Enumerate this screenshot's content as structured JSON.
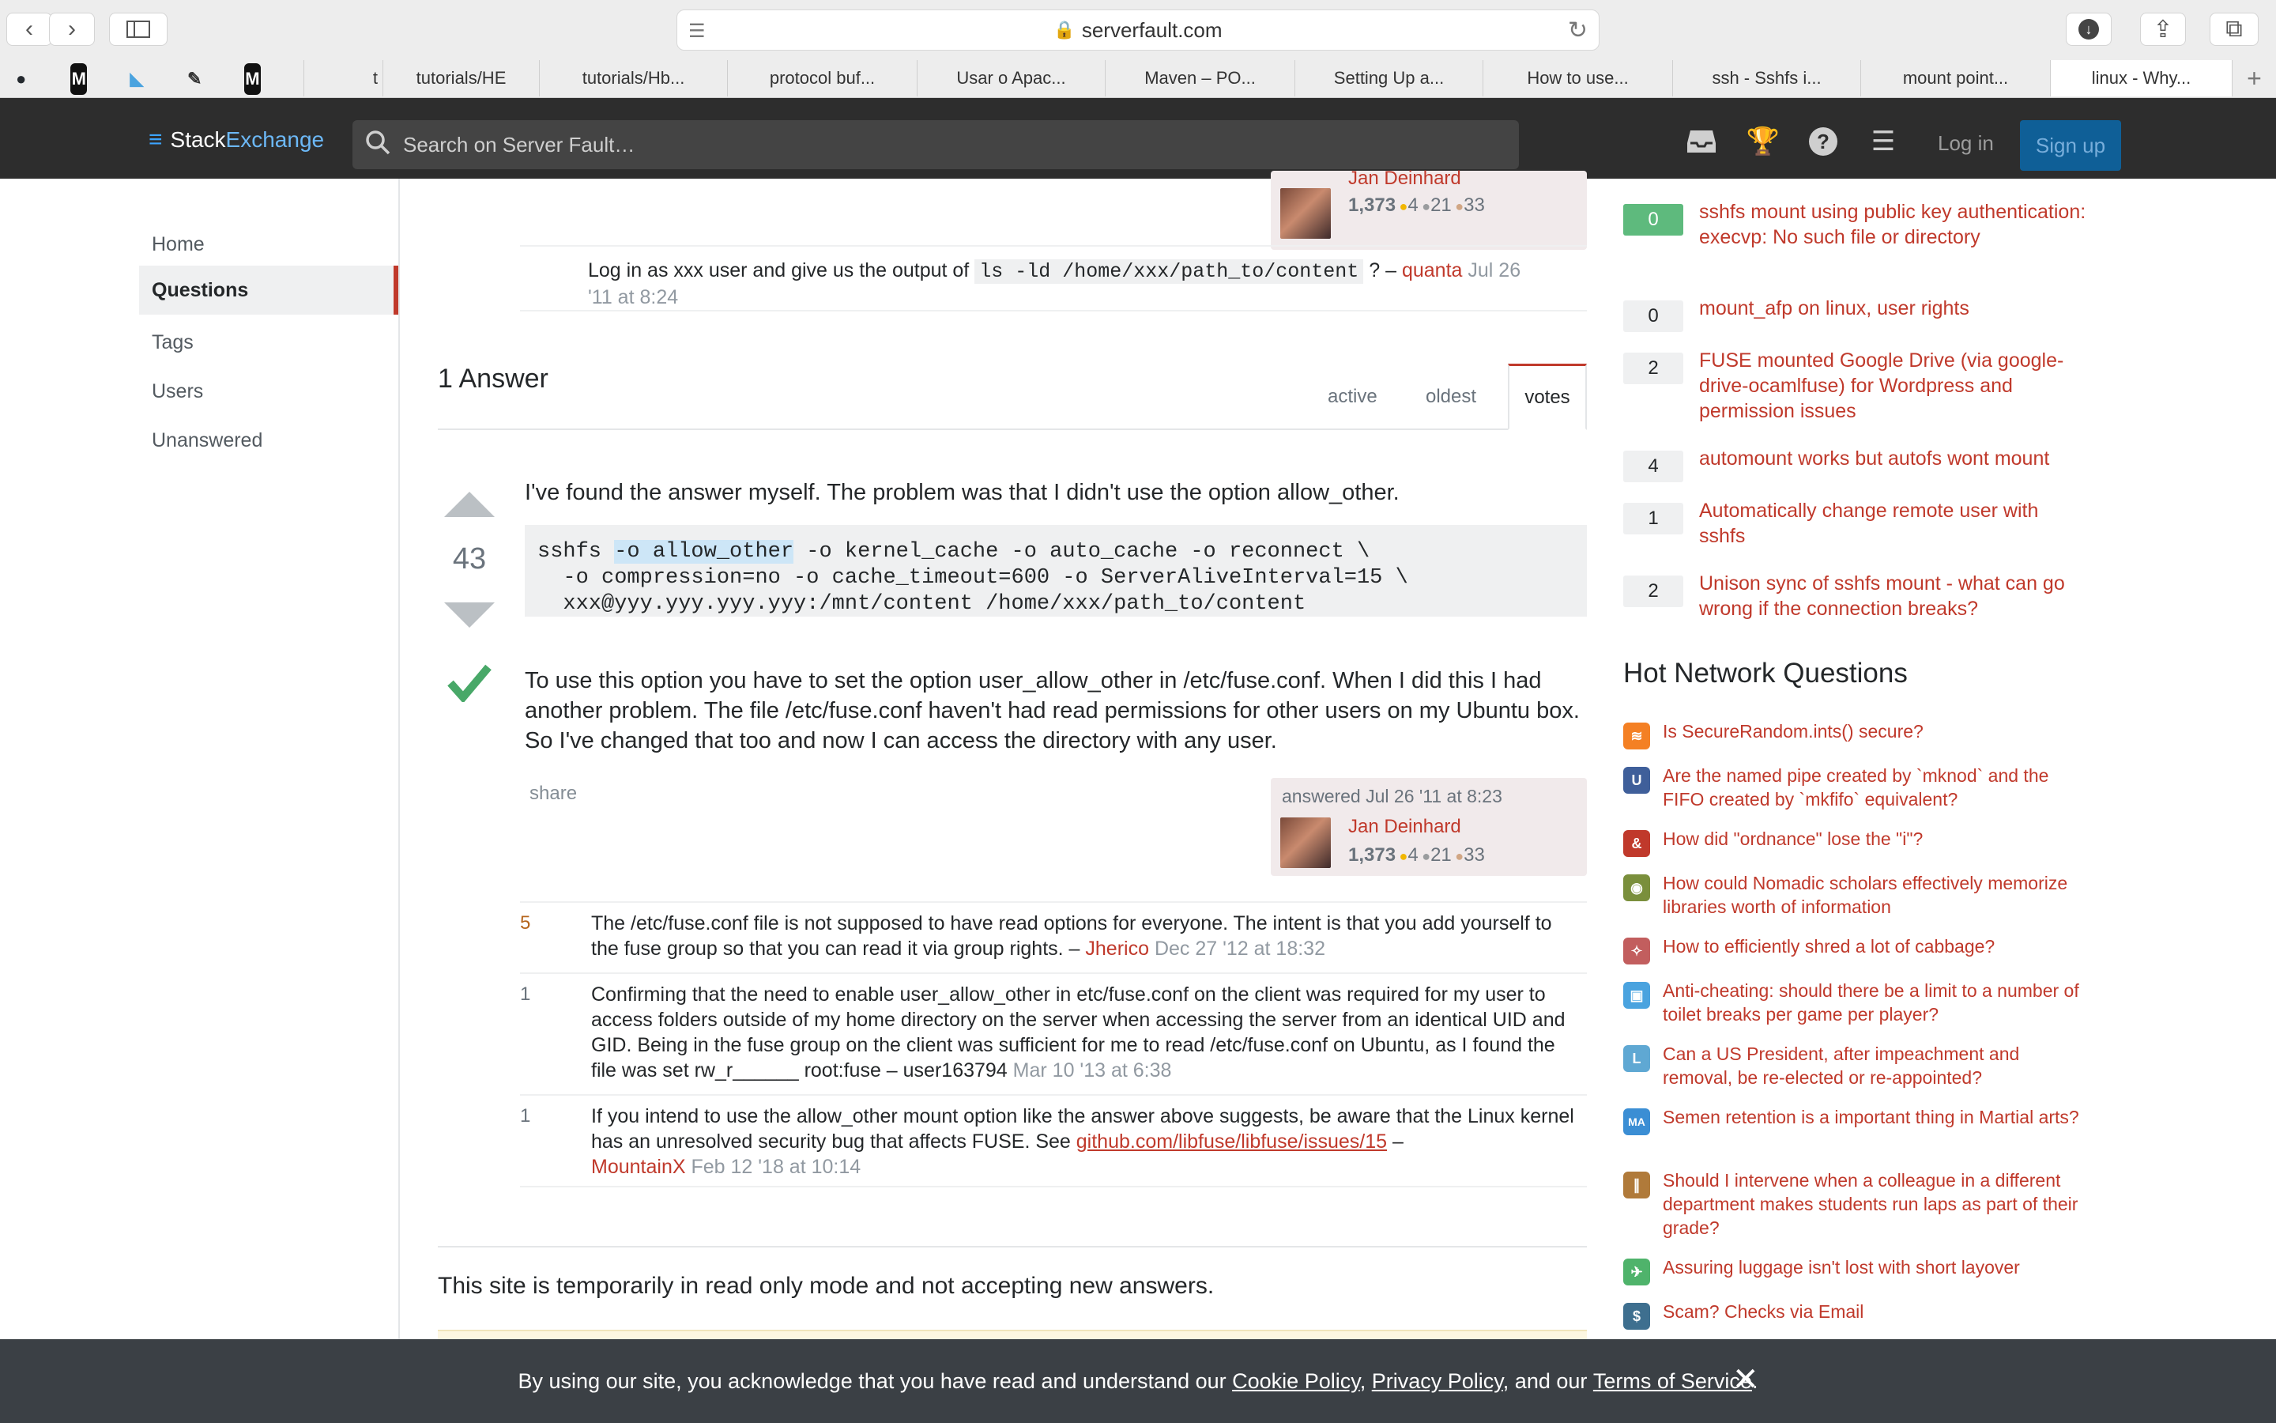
{
  "browser": {
    "url": "serverfault.com",
    "tabs": [
      "t",
      "tutorials/HE",
      "tutorials/Hb...",
      "protocol buf...",
      "Usar o Apac...",
      "Maven – PO...",
      "Setting Up a...",
      "How to use...",
      "ssh - Sshfs i...",
      "mount point...",
      "linux - Why..."
    ],
    "favicons": [
      "github-icon",
      "medium-icon",
      "bookmark-icon",
      "pin-icon",
      "medium-icon"
    ]
  },
  "header": {
    "brand_a": "Stack",
    "brand_b": "Exchange",
    "search_placeholder": "Search on Server Fault…",
    "login": "Log in",
    "signup": "Sign up"
  },
  "leftnav": {
    "items": [
      "Home",
      "Questions",
      "Tags",
      "Users",
      "Unanswered"
    ],
    "active": "Questions"
  },
  "question_signature": {
    "name": "Jan Deinhard",
    "rep": "1,373",
    "gold": "4",
    "silver": "21",
    "bronze": "33"
  },
  "question_comment": {
    "text_before": "Log in as xxx user and give us the output of",
    "code": "ls -ld /home/xxx/path_to/content",
    "text_after": "? –",
    "user": "quanta",
    "date_line1": "Jul 26",
    "date_line2": "'11 at 8:24"
  },
  "answers_header": {
    "title": "1 Answer",
    "tabs": [
      "active",
      "oldest",
      "votes"
    ],
    "active_tab": "votes"
  },
  "answer": {
    "votes": "43",
    "intro": "I've found the answer myself. The problem was that I didn't use the option allow_other.",
    "code_line1_pre": "sshfs ",
    "code_line1_hl": "-o allow_other",
    "code_line1_post": " -o kernel_cache -o auto_cache -o reconnect \\",
    "code_line2": "  -o compression=no -o cache_timeout=600 -o ServerAliveInterval=15 \\",
    "code_line3": "  xxx@yyy.yyy.yyy.yyy:/mnt/content /home/xxx/path_to/content",
    "para2": "To use this option you have to set the option user_allow_other in /etc/fuse.conf. When I did this I had another problem. The file /etc/fuse.conf haven't had read permissions for other users on my Ubuntu box. So I've changed that too and now I can access the directory with any user.",
    "share": "share",
    "answered": "answered Jul 26 '11 at 8:23",
    "user": "Jan Deinhard",
    "rep": "1,373",
    "gold": "4",
    "silver": "21",
    "bronze": "33"
  },
  "comments": [
    {
      "score": "5",
      "text": "The /etc/fuse.conf file is not supposed to have read options for everyone. The intent is that you add yourself to the fuse group so that you can read it via group rights. –",
      "user": "Jherico",
      "date": "Dec 27 '12 at 18:32"
    },
    {
      "score": "1",
      "text": "Confirming that the need to enable user_allow_other in etc/fuse.conf on the client was required for my user to access folders outside of my home directory on the server when accessing the server from an identical UID and GID. Being in the fuse group on the client was sufficient for me to read /etc/fuse.conf on Ubuntu, as I found the file was set rw_r______ root:fuse – user163794",
      "user": "",
      "date": "Mar 10 '13 at 6:38"
    },
    {
      "score": "1",
      "text": "If you intend to use the allow_other mount option like the answer above suggests, be aware that the Linux kernel has an unresolved security bug that affects FUSE. See",
      "link": "github.com/libfuse/libfuse/issues/15",
      "text2": "–",
      "user": "MountainX",
      "date": "Feb 12 '18 at 10:14"
    }
  ],
  "readonly_notice": "This site is temporarily in read only mode and not accepting new answers.",
  "related": [
    {
      "count": "0",
      "accepted": true,
      "title": "sshfs mount using public key authentication: execvp: No such file or directory"
    },
    {
      "count": "0",
      "accepted": false,
      "title": "mount_afp on linux, user rights"
    },
    {
      "count": "2",
      "accepted": false,
      "title": "FUSE mounted Google Drive (via google-drive-ocamlfuse) for Wordpress and permission issues"
    },
    {
      "count": "4",
      "accepted": false,
      "title": "automount works but autofs wont mount"
    },
    {
      "count": "1",
      "accepted": false,
      "title": "Automatically change remote user with sshfs"
    },
    {
      "count": "2",
      "accepted": false,
      "title": "Unison sync of sshfs mount - what can go wrong if the connection breaks?"
    }
  ],
  "hnq_title": "Hot Network Questions",
  "hnq": [
    {
      "icon": "stackoverflow-icon",
      "color": "#f48024",
      "title": "Is SecureRandom.ints() secure?"
    },
    {
      "icon": "unix-linux-icon",
      "color": "#3f5f9a",
      "title": "Are the named pipe created by `mknod` and the FIFO created by `mkfifo` equivalent?"
    },
    {
      "icon": "english-icon",
      "color": "#c0392b",
      "title": "How did \"ordnance\" lose the \"i\"?"
    },
    {
      "icon": "history-icon",
      "color": "#7a8f3c",
      "title": "How could Nomadic scholars effectively memorize libraries worth of information"
    },
    {
      "icon": "cooking-icon",
      "color": "#c25e5e",
      "title": "How to efficiently shred a lot of cabbage?"
    },
    {
      "icon": "gamedev-icon",
      "color": "#4aa3df",
      "title": "Anti-cheating: should there be a limit to a number of toilet breaks per game per player?"
    },
    {
      "icon": "law-icon",
      "color": "#5fa8d3",
      "title": "Can a US President, after impeachment and removal, be re-elected or re-appointed?"
    },
    {
      "icon": "martialarts-icon",
      "color": "#3b8ed4",
      "title": "Semen retention is a important thing in Martial arts?"
    },
    {
      "icon": "academia-icon",
      "color": "#b07a3a",
      "title": "Should I intervene when a colleague in a different department makes students run laps as part of their grade?"
    },
    {
      "icon": "travel-icon",
      "color": "#4fb36b",
      "title": "Assuring luggage isn't lost with short layover"
    },
    {
      "icon": "money-icon",
      "color": "#3e6f8f",
      "title": "Scam? Checks via Email"
    }
  ],
  "cookie": {
    "pre": "By using our site, you acknowledge that you have read and understand our",
    "cookie_policy": "Cookie Policy",
    "sep": ",",
    "privacy": "Privacy Policy",
    "and": ", and our",
    "tos": "Terms of Service",
    "end": "."
  }
}
